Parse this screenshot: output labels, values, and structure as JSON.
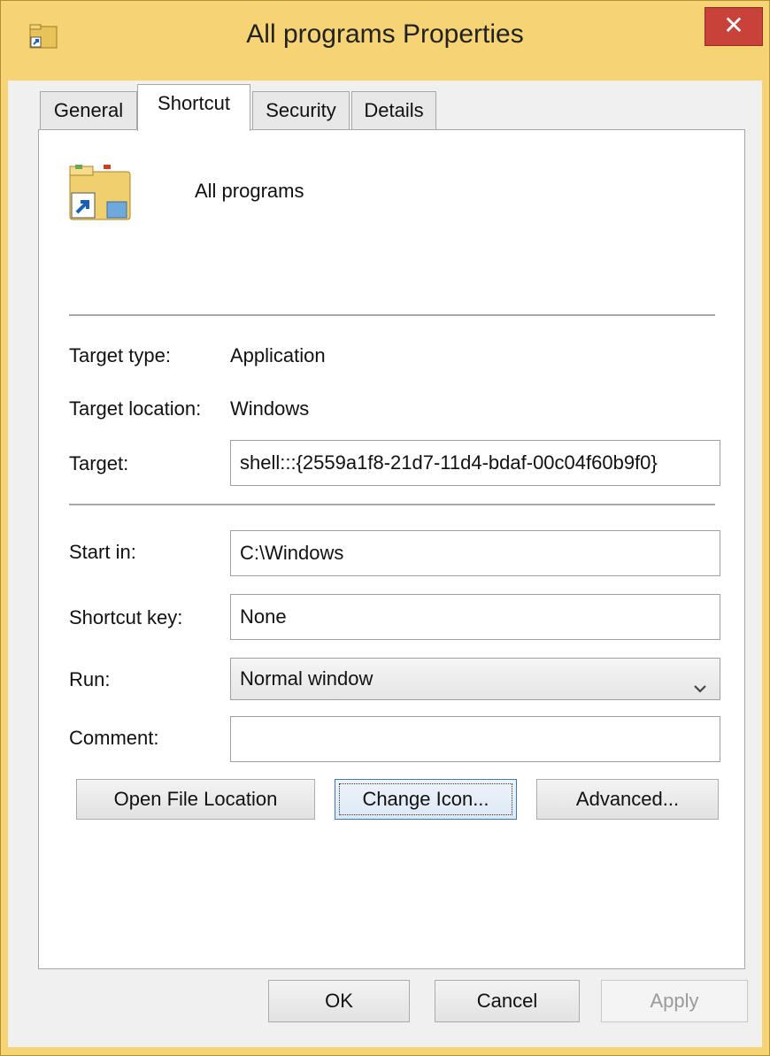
{
  "window": {
    "title": "All programs Properties",
    "close_label": "✕"
  },
  "tabs": [
    {
      "label": "General"
    },
    {
      "label": "Shortcut"
    },
    {
      "label": "Security"
    },
    {
      "label": "Details"
    }
  ],
  "shortcut": {
    "name": "All programs",
    "target_type_label": "Target type:",
    "target_type_value": "Application",
    "target_location_label": "Target location:",
    "target_location_value": "Windows",
    "target_label": "Target:",
    "target_value": "shell:::{2559a1f8-21d7-11d4-bdaf-00c04f60b9f0}",
    "start_in_label": "Start in:",
    "start_in_value": "C:\\Windows",
    "shortcut_key_label": "Shortcut key:",
    "shortcut_key_value": "None",
    "run_label": "Run:",
    "run_value": "Normal window",
    "comment_label": "Comment:",
    "comment_value": ""
  },
  "action_buttons": {
    "open_file_location": "Open File Location",
    "change_icon": "Change Icon...",
    "advanced": "Advanced..."
  },
  "dialog_buttons": {
    "ok": "OK",
    "cancel": "Cancel",
    "apply": "Apply"
  },
  "colors": {
    "title_bar": "#f6d475",
    "close_button": "#c7433a",
    "focus_border": "#3d7bad"
  }
}
